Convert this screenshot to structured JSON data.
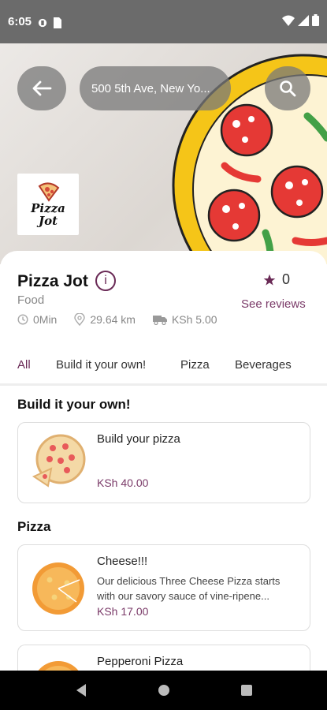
{
  "status_bar": {
    "time": "6:05"
  },
  "header": {
    "search_text": "500 5th Ave, New Yo..."
  },
  "store": {
    "logo_text_line1": "Pizza",
    "logo_text_line2": "Jot",
    "name": "Pizza Jot",
    "info_label": "i",
    "rating": "0",
    "see_reviews": "See reviews",
    "category": "Food",
    "delivery_time": "0Min",
    "distance": "29.64 km",
    "delivery_fee": "KSh 5.00"
  },
  "tabs": [
    {
      "label": "All",
      "active": true
    },
    {
      "label": "Build it your own!"
    },
    {
      "label": "Pizza"
    },
    {
      "label": "Beverages"
    }
  ],
  "sections": [
    {
      "title": "Build it your own!",
      "items": [
        {
          "name": "Build your pizza",
          "description": "",
          "price": "KSh 40.00"
        }
      ]
    },
    {
      "title": "Pizza",
      "items": [
        {
          "name": "Cheese!!!",
          "description": "Our delicious Three Cheese Pizza starts with our savory sauce of vine-ripene...",
          "price": "KSh 17.00"
        },
        {
          "name": "Pepperoni Pizza",
          "description": "",
          "price": ""
        }
      ]
    }
  ],
  "colors": {
    "accent": "#6a2a56",
    "price": "#7a3a68"
  }
}
